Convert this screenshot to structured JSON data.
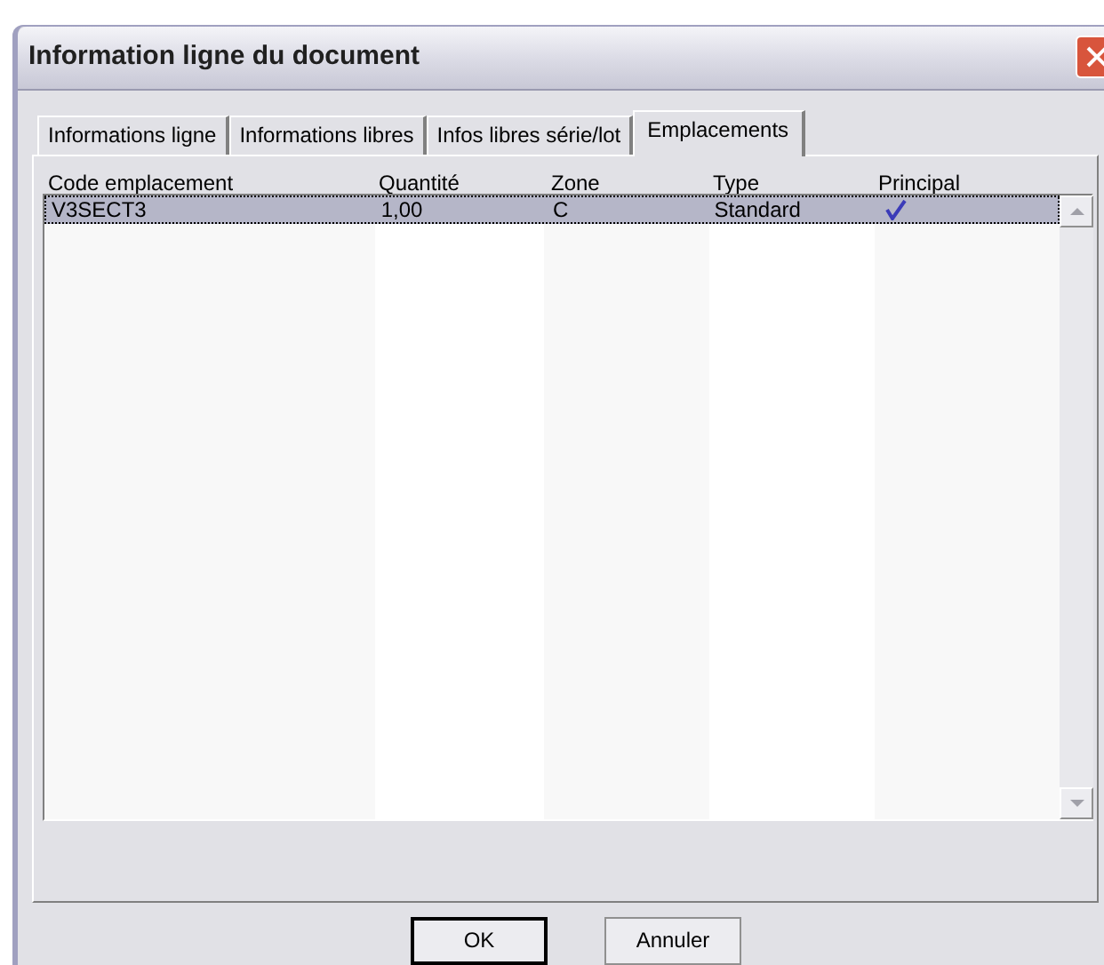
{
  "window": {
    "title": "Information ligne du document"
  },
  "tabs": [
    {
      "label": "Informations ligne",
      "selected": false
    },
    {
      "label": "Informations libres",
      "selected": false
    },
    {
      "label": "Infos libres série/lot",
      "selected": false
    },
    {
      "label": "Emplacements",
      "selected": true
    }
  ],
  "table": {
    "columns": [
      "Code emplacement",
      "Quantité",
      "Zone",
      "Type",
      "Principal"
    ],
    "rows": [
      {
        "code": "V3SECT3",
        "quantite": "1,00",
        "zone": "C",
        "type": "Standard",
        "principal": true,
        "selected": true
      }
    ]
  },
  "buttons": [
    {
      "label": "OK",
      "default": true
    },
    {
      "label": "Annuler",
      "default": false
    }
  ]
}
